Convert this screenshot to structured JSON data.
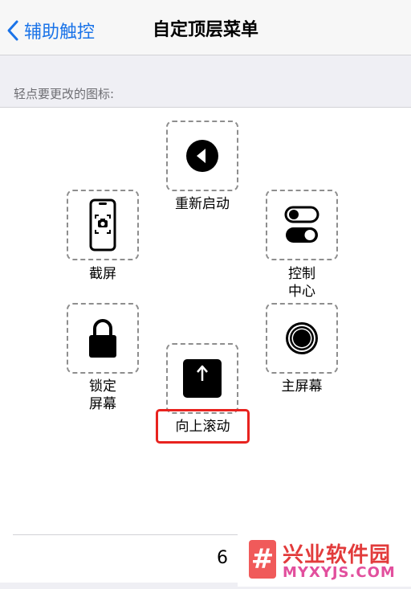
{
  "nav": {
    "back_label": "辅助触控",
    "title": "自定顶层菜单"
  },
  "section": {
    "header": "轻点要更改的图标:"
  },
  "items": {
    "restart": "重新启动",
    "screenshot": "截屏",
    "control_center_line1": "控制",
    "control_center_line2": "中心",
    "lock_line1": "锁定",
    "lock_line2": "屏幕",
    "scroll_up": "向上滚动",
    "home": "主屏幕"
  },
  "footer": {
    "count": "6"
  },
  "watermark": {
    "logo": "#",
    "name": "兴业软件园",
    "url": "MYXYJS.COM"
  },
  "colors": {
    "accent": "#1a73e8",
    "highlight": "#e8231f"
  }
}
